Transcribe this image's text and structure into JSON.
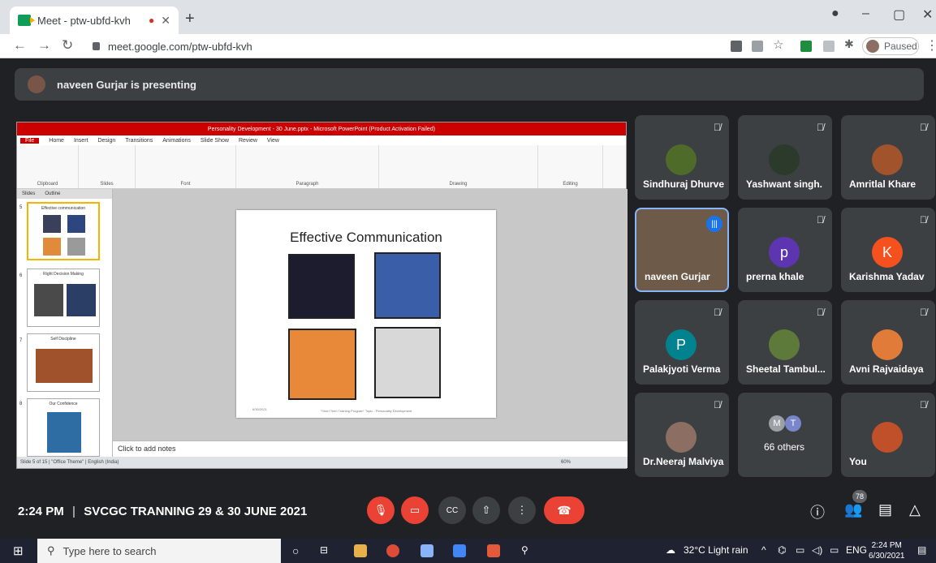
{
  "browser": {
    "tab_title": "Meet - ptw-ubfd-kvh",
    "url": "meet.google.com/ptw-ubfd-kvh",
    "profile_status": "Paused",
    "new_tab": "+",
    "minimize": "–",
    "maximize": "▢",
    "close": "✕"
  },
  "presenting": {
    "text": "naveen Gurjar is presenting"
  },
  "powerpoint": {
    "title": "Personality Development - 30 June.pptx - Microsoft PowerPoint (Product Activation Failed)",
    "tabs": [
      "File",
      "Home",
      "Insert",
      "Design",
      "Transitions",
      "Animations",
      "Slide Show",
      "Review",
      "View"
    ],
    "groups": [
      "Clipboard",
      "Slides",
      "Font",
      "Paragraph",
      "Drawing",
      "Editing"
    ],
    "panel_tabs": [
      "Slides",
      "Outline"
    ],
    "thumbnails": [
      {
        "num": "5",
        "title": "Effective communication"
      },
      {
        "num": "6",
        "title": "Right Decision Making"
      },
      {
        "num": "7",
        "title": "Self Discipline"
      },
      {
        "num": "8",
        "title": "Our Confidence"
      }
    ],
    "slide_title": "Effective Communication",
    "slide_date": "6/30/2021",
    "slide_footer": "\"Short Term Training Program\" Topic - Personality Development",
    "notes": "Click to add notes",
    "status": "Slide 5 of 15  |  \"Office Theme\"  |  English (India)",
    "zoom": "60%"
  },
  "participants": [
    {
      "name": "Sindhuraj Dhurve",
      "initial": "",
      "color": "#4e6b2a"
    },
    {
      "name": "Yashwant singh.",
      "initial": "",
      "color": "#2b3a2b"
    },
    {
      "name": "Amritlal Khare",
      "initial": "",
      "color": "#a1542c"
    },
    {
      "name": "naveen Gurjar",
      "initial": "",
      "color": "#6d5a48"
    },
    {
      "name": "prerna khale",
      "initial": "p",
      "color": "#5e35b1"
    },
    {
      "name": "Karishma Yadav",
      "initial": "K",
      "color": "#f4511e"
    },
    {
      "name": "Palakjyoti Verma",
      "initial": "P",
      "color": "#00838f"
    },
    {
      "name": "Sheetal Tambul...",
      "initial": "",
      "color": "#5d7a3a"
    },
    {
      "name": "Avni Rajvaidaya",
      "initial": "",
      "color": "#e07b39"
    },
    {
      "name": "Dr.Neeraj Malviya",
      "initial": "",
      "color": "#8d6e63"
    },
    {
      "name": "66 others",
      "initial": "",
      "color": ""
    },
    {
      "name": "You",
      "initial": "",
      "color": "#c0502a"
    }
  ],
  "others_avatars": [
    "M",
    "T"
  ],
  "meeting": {
    "time": "2:24 PM",
    "title": "SVCGC TRANNING 29 & 30 JUNE 2021",
    "people_count": "78"
  },
  "taskbar": {
    "search_placeholder": "Type here to search",
    "weather": "32°C  Light rain",
    "lang": "ENG",
    "time": "2:24 PM",
    "date": "6/30/2021"
  }
}
